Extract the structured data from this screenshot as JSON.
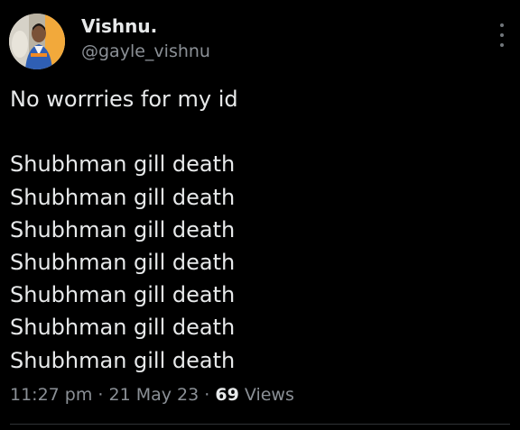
{
  "author": {
    "display_name": "Vishnu.",
    "handle": "@gayle_vishnu"
  },
  "tweet": {
    "lines": [
      "No worrries for my id",
      "",
      "Shubhman gill death",
      "Shubhman gill death",
      "Shubhman gill death",
      "Shubhman gill death",
      "Shubhman gill death",
      "Shubhman gill death",
      "Shubhman gill death"
    ]
  },
  "meta": {
    "time": "11:27 pm",
    "separator": "·",
    "date": "21 May 23",
    "views_count": "69",
    "views_label": "Views"
  },
  "icons": {
    "more": "more-vertical-icon",
    "avatar": "profile-photo"
  },
  "colors": {
    "background": "#000000",
    "primary_text": "#e7e9ea",
    "secondary_text": "#8b9096",
    "divider": "#2f3336"
  }
}
